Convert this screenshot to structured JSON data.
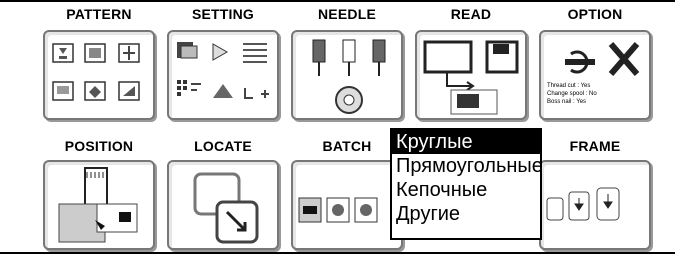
{
  "tiles": {
    "pattern": {
      "label": "PATTERN",
      "icon": "pattern-grid-icon"
    },
    "setting": {
      "label": "SETTING",
      "icon": "setting-tools-icon"
    },
    "needle": {
      "label": "NEEDLE",
      "icon": "needle-bar-icon"
    },
    "read": {
      "label": "READ",
      "icon": "read-disk-icon"
    },
    "option": {
      "label": "OPTION",
      "icon": "option-tools-icon",
      "lines": [
        "Thread cut  : Yes",
        "Change spool : No",
        "Boss nail  : Yes"
      ]
    },
    "position": {
      "label": "POSITION",
      "icon": "position-icon"
    },
    "locate": {
      "label": "LOCATE",
      "icon": "locate-icon"
    },
    "batch": {
      "label": "BATCH",
      "icon": "batch-icon"
    },
    "frame": {
      "label": "FRAME",
      "icon": "frame-icon"
    }
  },
  "dropdown": {
    "items": [
      {
        "label": "Круглые",
        "selected": true
      },
      {
        "label": "Прямоугольные",
        "selected": false
      },
      {
        "label": "Кепочные",
        "selected": false
      },
      {
        "label": "Другие",
        "selected": false
      }
    ]
  },
  "colors": {
    "selected_bg": "#000000",
    "selected_fg": "#ffffff",
    "tile_border": "#777777"
  }
}
